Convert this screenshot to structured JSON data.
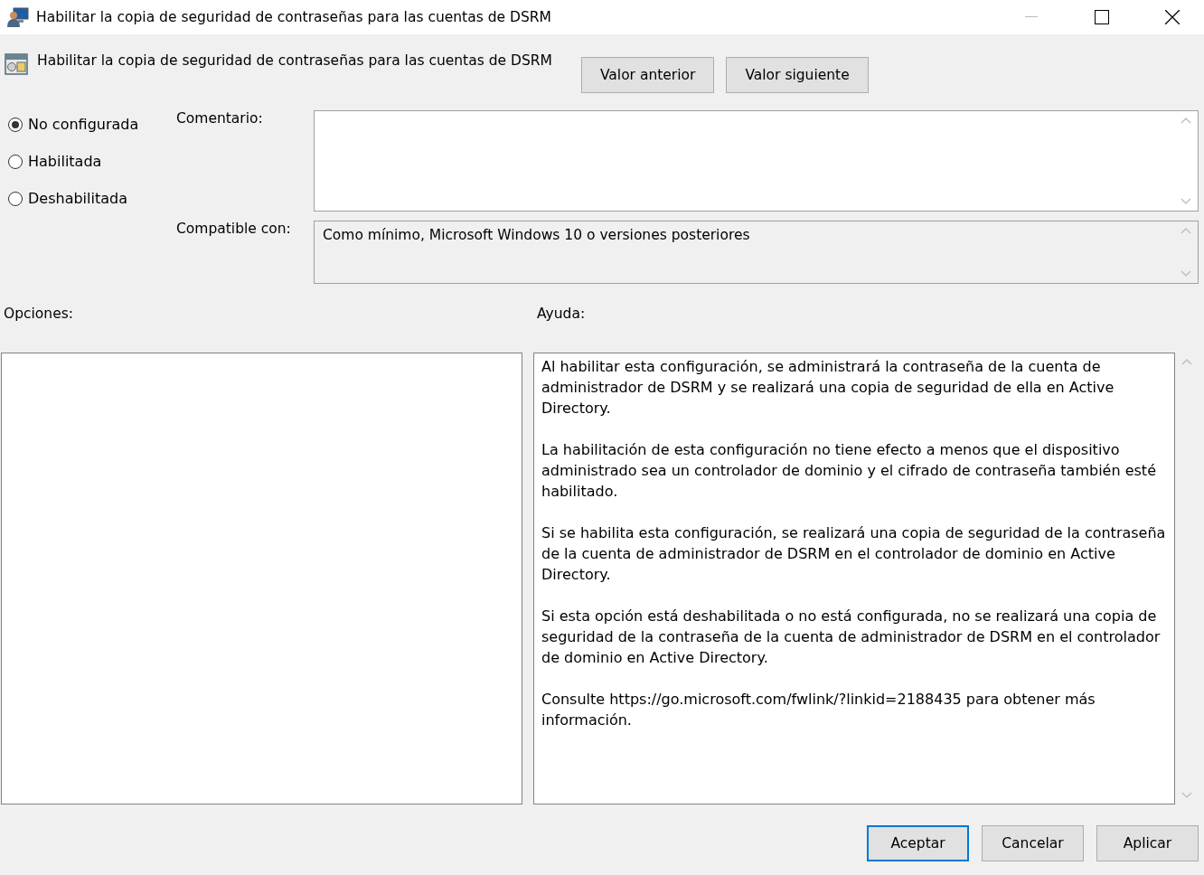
{
  "window": {
    "title": "Habilitar la copia de seguridad de contraseñas para las cuentas de DSRM"
  },
  "header": {
    "policy_name": "Habilitar la copia de seguridad de contraseñas para las cuentas de DSRM",
    "nav_buttons": [
      "Valor anterior",
      "Valor siguiente"
    ]
  },
  "state_options": [
    {
      "label": "No configurada",
      "selected": true
    },
    {
      "label": "Habilitada",
      "selected": false
    },
    {
      "label": "Deshabilitada",
      "selected": false
    }
  ],
  "comment": {
    "label": "Comentario:"
  },
  "supported_on": {
    "label": "Compatible con:",
    "value": "Como mínimo, Microsoft Windows 10 o versiones posteriores"
  },
  "options": {
    "label": "Opciones:"
  },
  "help": {
    "label": "Ayuda:",
    "paragraphs": [
      "Al habilitar esta configuración, se administrará la contraseña de la cuenta de administrador de DSRM y se realizará una copia de seguridad de ella en Active Directory.",
      "La habilitación de esta configuración no tiene efecto a menos que el dispositivo administrado sea un controlador de dominio y el cifrado de contraseña también esté habilitado.",
      "Si se habilita esta configuración, se realizará una copia de seguridad de la contraseña de la cuenta de administrador de DSRM en el controlador de dominio en Active Directory.",
      "Si esta opción está deshabilitada o no está configurada, no se realizará una copia de seguridad de la contraseña de la cuenta de administrador de DSRM en el controlador de dominio en Active Directory.",
      "Consulte https://go.microsoft.com/fwlink/?linkid=2188435 para obtener más información."
    ]
  },
  "footer_buttons": [
    {
      "label": "Aceptar",
      "default": true
    },
    {
      "label": "Cancelar",
      "default": false
    },
    {
      "label": "Aplicar",
      "default": false
    }
  ]
}
